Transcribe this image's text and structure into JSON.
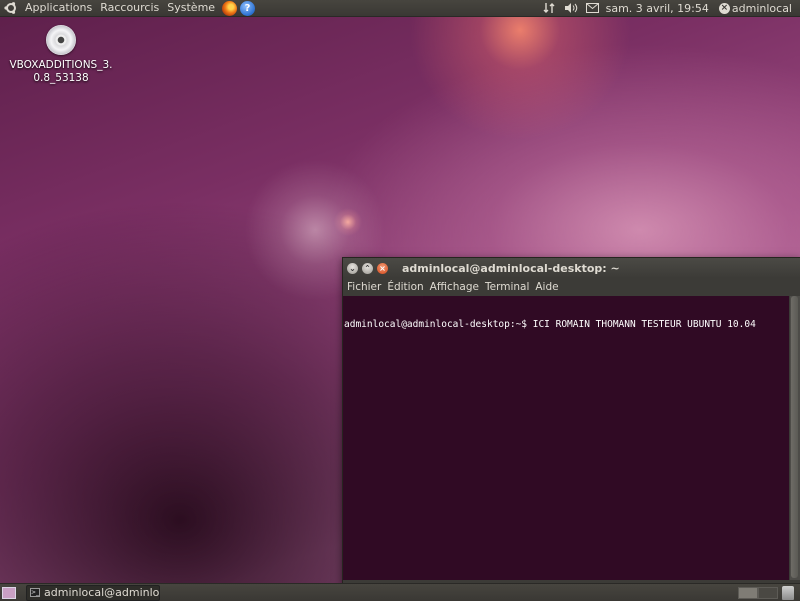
{
  "top_panel": {
    "menus": [
      "Applications",
      "Raccourcis",
      "Système"
    ],
    "clock": "sam.  3 avril, 19:54",
    "user": "adminlocal"
  },
  "desktop": {
    "icons": [
      {
        "label": "VBOXADDITIONS_3.\n0.8_53138",
        "icon": "cd-icon"
      }
    ]
  },
  "terminal": {
    "title": "adminlocal@adminlocal-desktop: ~",
    "menu": [
      "Fichier",
      "Édition",
      "Affichage",
      "Terminal",
      "Aide"
    ],
    "lines": [
      "adminlocal@adminlocal-desktop:~$ ICI ROMAIN THOMANN TESTEUR UBUNTU 10.04"
    ],
    "background_color": "#300a24"
  },
  "bottom_panel": {
    "task_label": "adminlocal@adminloc..."
  }
}
